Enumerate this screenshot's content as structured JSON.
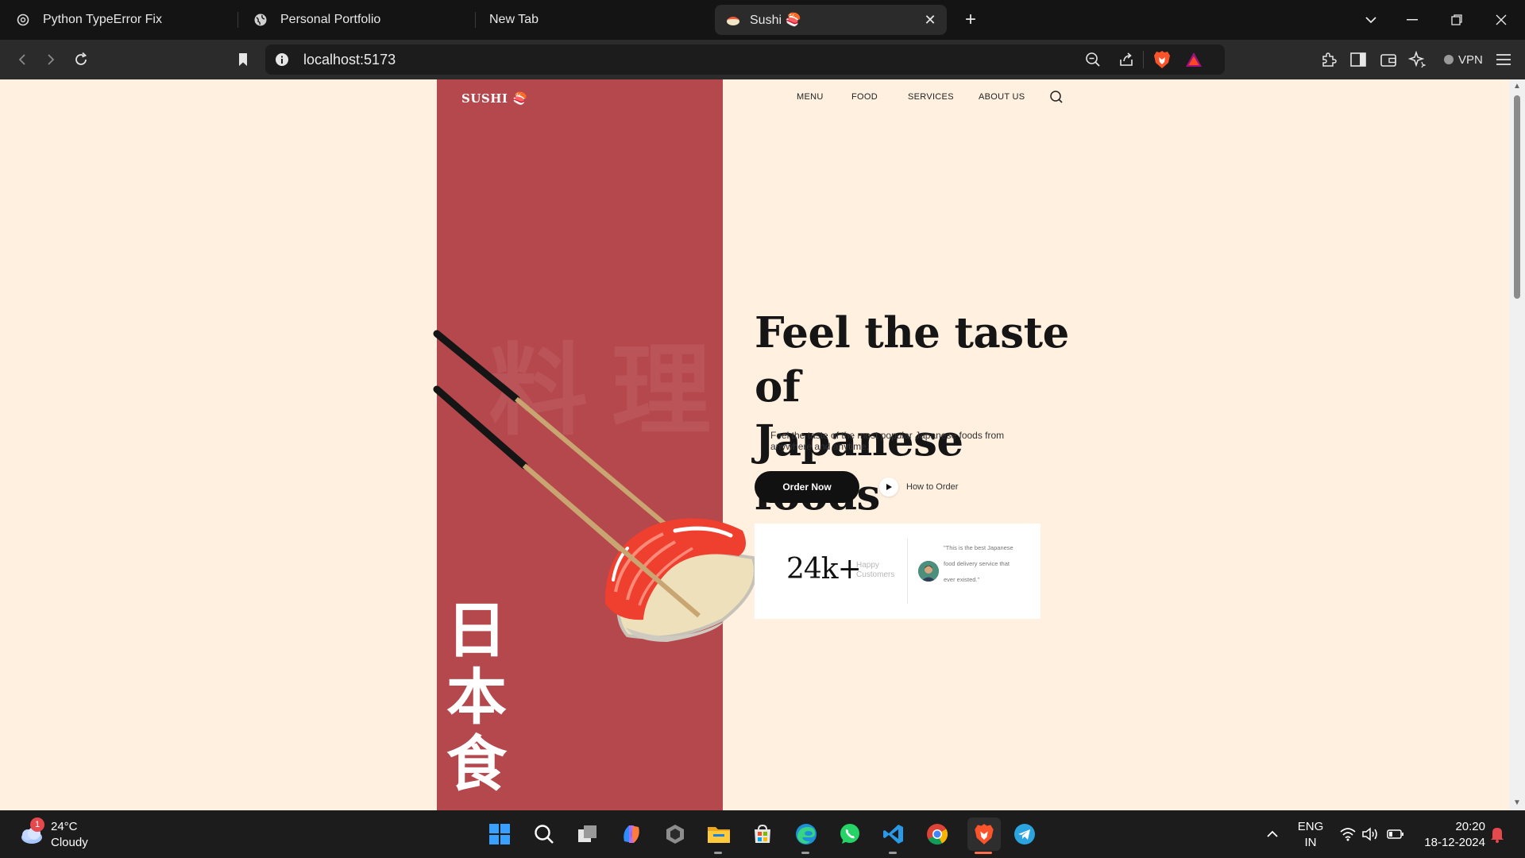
{
  "browser": {
    "tabs": [
      {
        "title": "Python TypeError Fix",
        "icon": "openai-icon"
      },
      {
        "title": "Personal Portfolio",
        "icon": "globe-icon"
      },
      {
        "title": "New Tab",
        "icon": ""
      },
      {
        "title": "Sushi 🍣",
        "icon": "sushi-favicon",
        "active": true
      }
    ],
    "url": "localhost:5173",
    "vpn_label": "VPN"
  },
  "site": {
    "logo": "SUSHI 🍣",
    "nav": [
      "MENU",
      "FOOD",
      "SERVICES",
      "ABOUT US"
    ],
    "bg_kanji": "料理",
    "vertical_kanji": [
      "日",
      "本",
      "食"
    ],
    "hero": {
      "title_line1": "Feel the taste of",
      "title_line2": "Japanese foods",
      "subtitle": "Feel the taste of the most popular Japanese foods from anywhere and anytime.",
      "order_button": "Order Now",
      "how_to_order": "How to Order"
    },
    "stats": {
      "number": "24k+",
      "label": "Happy Customers",
      "quote": "\"This is the best Japanese food delivery service that ever existed.\""
    }
  },
  "taskbar": {
    "weather_temp": "24°C",
    "weather_desc": "Cloudy",
    "weather_badge": "1",
    "lang_line1": "ENG",
    "lang_line2": "IN",
    "time": "20:20",
    "date": "18-12-2024"
  },
  "colors": {
    "accent_red": "#b5484d",
    "page_bg": "#fff0e0",
    "button_dark": "#111111"
  }
}
